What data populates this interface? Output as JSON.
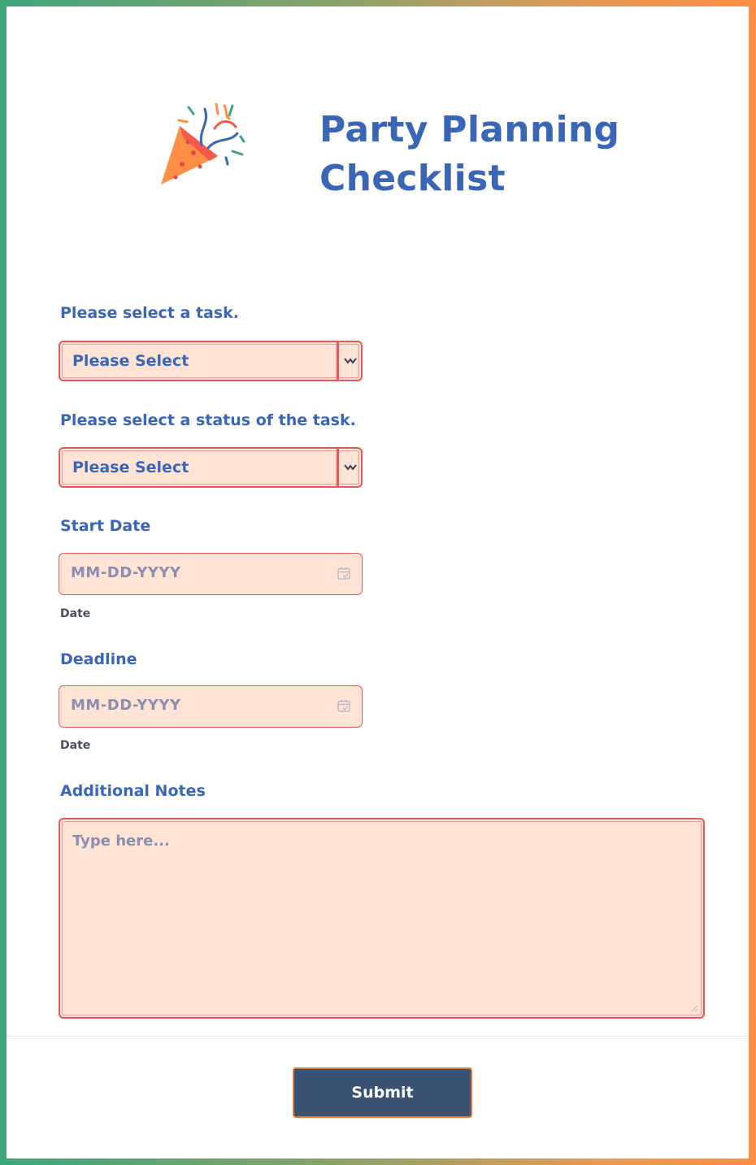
{
  "header": {
    "title_line1": "Party Planning",
    "title_line2": "Checklist",
    "icon": "party-popper-icon"
  },
  "fields": {
    "task": {
      "label": "Please select a task.",
      "value": "Please Select"
    },
    "status": {
      "label": "Please select a status of the task.",
      "value": "Please Select"
    },
    "start_date": {
      "label": "Start Date",
      "placeholder": "MM-DD-YYYY",
      "sublabel": "Date"
    },
    "deadline": {
      "label": "Deadline",
      "placeholder": "MM-DD-YYYY",
      "sublabel": "Date"
    },
    "notes": {
      "label": "Additional Notes",
      "placeholder": "Type here..."
    }
  },
  "submit": {
    "label": "Submit"
  },
  "colors": {
    "accent": "#3b66b5",
    "field_bg": "#ffe4d6",
    "field_border": "#e65a5a",
    "button_bg": "#3a5273",
    "button_border": "#d97a3a",
    "frame_left": "#3fa57b",
    "frame_right": "#ff8f45"
  }
}
